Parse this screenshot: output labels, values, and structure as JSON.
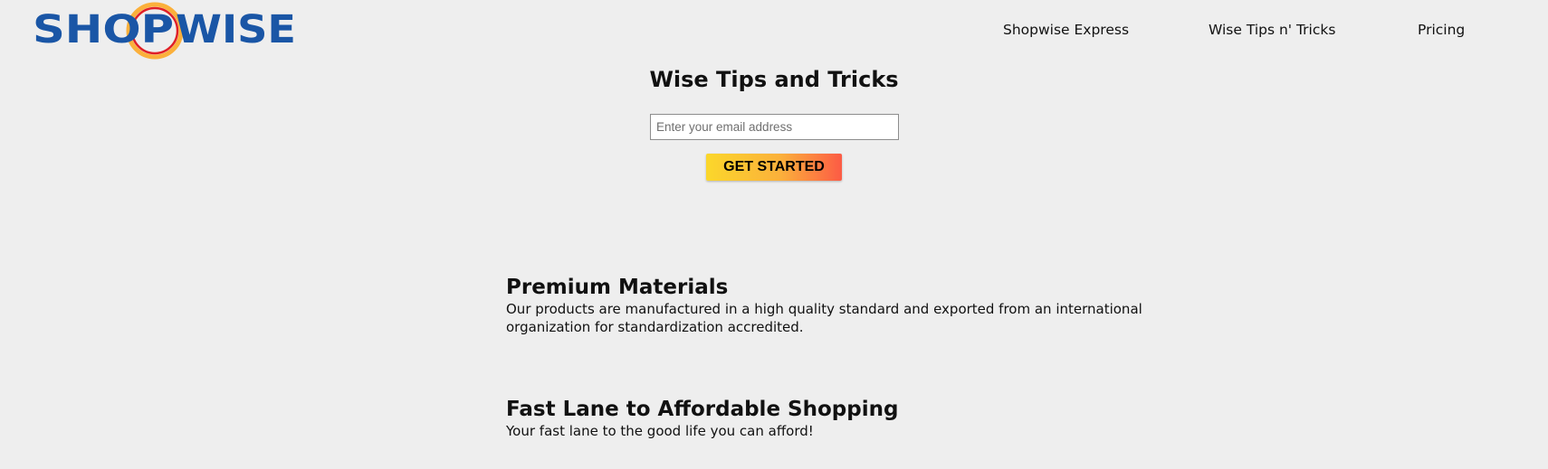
{
  "brand": {
    "logo_text_left": "SHOP",
    "logo_text_right": "WISE",
    "primary_color": "#1a56a6",
    "accent_red": "#e02027",
    "accent_yellow": "#fbb03b"
  },
  "nav": {
    "items": [
      {
        "label": "Shopwise Express"
      },
      {
        "label": "Wise Tips n' Tricks"
      },
      {
        "label": "Pricing"
      }
    ]
  },
  "hero": {
    "title": "Wise Tips and Tricks",
    "email_placeholder": "Enter your email address",
    "email_value": "",
    "cta_label": "GET STARTED"
  },
  "features": [
    {
      "title": "Premium Materials",
      "description": "Our products are manufactured in a high quality standard and exported from an international organization for standardization accredited."
    },
    {
      "title": "Fast Lane to Affordable Shopping",
      "description": "Your fast lane to the good life you can afford!"
    }
  ],
  "colors": {
    "page_background": "#eeeeee",
    "text": "#111111",
    "cta_gradient_start": "#fbd72b",
    "cta_gradient_end": "#fc5b45"
  }
}
